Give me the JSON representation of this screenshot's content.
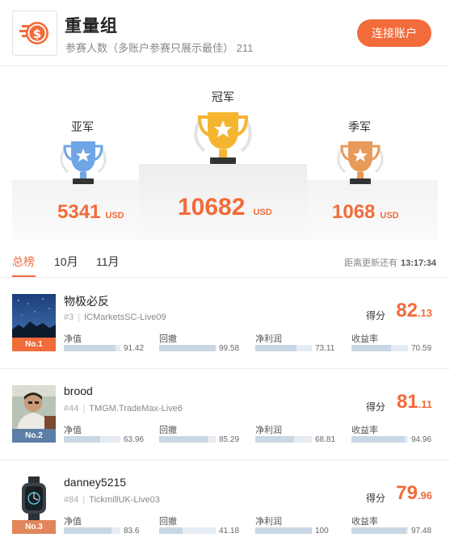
{
  "header": {
    "title": "重量组",
    "subtitle": "参赛人数（多账户参赛只展示最佳） 211",
    "connect_label": "连接账户"
  },
  "podium": {
    "second": {
      "label": "亚军",
      "amount": "5341",
      "currency": "USD",
      "color": "#6fa5e6"
    },
    "first": {
      "label": "冠军",
      "amount": "10682",
      "currency": "USD",
      "color": "#f5b531"
    },
    "third": {
      "label": "季军",
      "amount": "1068",
      "currency": "USD",
      "color": "#e89a5a"
    }
  },
  "tabs": [
    {
      "label": "总榜",
      "active": true
    },
    {
      "label": "10月",
      "active": false
    },
    {
      "label": "11月",
      "active": false
    }
  ],
  "countdown": {
    "label": "距离更新还有",
    "time": "13:17:34"
  },
  "score_label": "得分",
  "metric_labels": [
    "净值",
    "回撤",
    "净利润",
    "收益率"
  ],
  "entries": [
    {
      "name": "物极必反",
      "rank": "#3",
      "server": "ICMarketsSC-Live09",
      "badge": "No.1",
      "badge_color": "#f26b3a",
      "score_int": "82",
      "score_dec": ".13",
      "metrics": [
        91.42,
        99.58,
        73.11,
        70.59
      ],
      "metric_text": [
        "91.42",
        "99.58",
        "73.11",
        "70.59"
      ]
    },
    {
      "name": "brood",
      "rank": "#44",
      "server": "TMGM.TradeMax-Live6",
      "badge": "No.2",
      "badge_color": "#5d7fa6",
      "score_int": "81",
      "score_dec": ".11",
      "metrics": [
        63.96,
        85.29,
        68.81,
        94.96
      ],
      "metric_text": [
        "63.96",
        "85.29",
        "68.81",
        "94.96"
      ]
    },
    {
      "name": "danney5215",
      "rank": "#84",
      "server": "TickmillUK-Live03",
      "badge": "No.3",
      "badge_color": "#e0865a",
      "score_int": "79",
      "score_dec": ".96",
      "metrics": [
        83.6,
        41.18,
        100,
        97.48
      ],
      "metric_text": [
        "83.6",
        "41.18",
        "100",
        "97.48"
      ]
    }
  ]
}
